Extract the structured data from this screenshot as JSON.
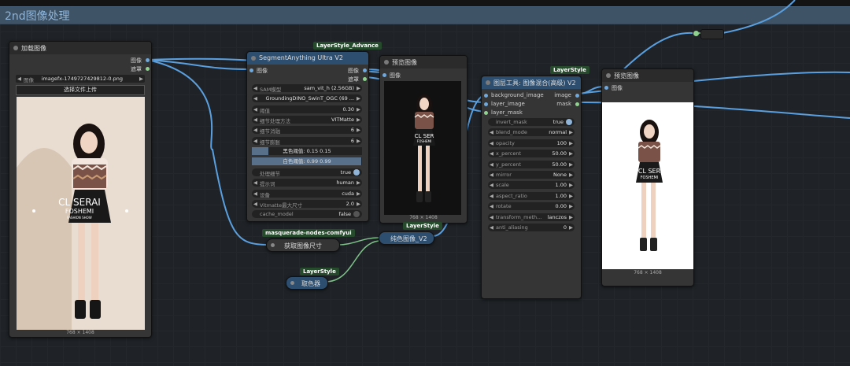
{
  "group": {
    "title": "2nd图像处理"
  },
  "load_image": {
    "title": "加载图像",
    "out_image": "图像",
    "out_mask": "遮罩",
    "image_label": "图像",
    "image_value": "imagefx-1749727429812-0.png",
    "upload_label": "选择文件上传",
    "size_caption": "768 × 1408"
  },
  "segment": {
    "badge": "LayerStyle_Advance",
    "title": "SegmentAnything Ultra V2",
    "in_image": "图像",
    "out_image": "图像",
    "out_mask": "遮罩",
    "widgets": [
      {
        "label": "SAM模型",
        "value": "sam_vit_h (2.56GB)"
      },
      {
        "label": "",
        "value": "GroundingDINO_SwinT_OGC (69 ..."
      },
      {
        "label": "阈值",
        "value": "0.30"
      },
      {
        "label": "细节处理方法",
        "value": "VITMatte"
      },
      {
        "label": "细节消融",
        "value": "6"
      },
      {
        "label": "细节膨胀",
        "value": "6"
      }
    ],
    "black_point": {
      "label": "黑色阈值:",
      "value": "0.15",
      "fraction": 0.15
    },
    "white_point": {
      "label": "白色阈值:",
      "value": "0.99",
      "fraction": 0.99
    },
    "widgets2": [
      {
        "label": "处理细节",
        "value": "true",
        "toggle": true
      },
      {
        "label": "提示词",
        "value": "human"
      },
      {
        "label": "设备",
        "value": "cuda"
      },
      {
        "label": "Vitmatte最大尺寸",
        "value": "2.0"
      },
      {
        "label": "cache_model",
        "value": "false",
        "toggle": true
      }
    ]
  },
  "preview1": {
    "title": "预览图像",
    "in_image": "图像",
    "size_caption": "768 × 1408"
  },
  "get_size": {
    "badge": "masquerade-nodes-comfyui",
    "title": "获取图像尺寸"
  },
  "solid": {
    "badge": "LayerStyle",
    "title": "纯色图像_V2"
  },
  "color_picker": {
    "badge": "LayerStyle",
    "title": "取色器"
  },
  "blend": {
    "badge": "LayerStyle",
    "title": "图层工具: 图像混合(高级) V2",
    "inputs": [
      "background_image",
      "layer_image",
      "layer_mask"
    ],
    "outputs": [
      "image",
      "mask"
    ],
    "widgets": [
      {
        "label": "invert_mask",
        "value": "true",
        "toggle": true
      },
      {
        "label": "blend_mode",
        "value": "normal"
      },
      {
        "label": "opacity",
        "value": "100"
      },
      {
        "label": "x_percent",
        "value": "50.00"
      },
      {
        "label": "y_percent",
        "value": "50.00"
      },
      {
        "label": "mirror",
        "value": "None"
      },
      {
        "label": "scale",
        "value": "1.00"
      },
      {
        "label": "aspect_ratio",
        "value": "1.00"
      },
      {
        "label": "rotate",
        "value": "0.00"
      },
      {
        "label": "transform_meth...",
        "value": "lanczos"
      },
      {
        "label": "anti_aliasing",
        "value": "0"
      }
    ]
  },
  "preview2": {
    "title": "预览图像",
    "in_image": "图像",
    "size_caption": "768 × 1408"
  },
  "photo": {
    "brand_big": "CL SERAI",
    "brand_small": "FOSHEMI",
    "brand_tag": "FASHION SHOW",
    "bg_color": "#e9ddd2",
    "dress_top": "#7a5247",
    "hair": "#1a1210"
  },
  "colors": {
    "wire_blue": "#5aa0e0",
    "wire_green": "#7fc28a",
    "badge_green": "#264a2c",
    "node_blue": "#2d4e6e"
  }
}
